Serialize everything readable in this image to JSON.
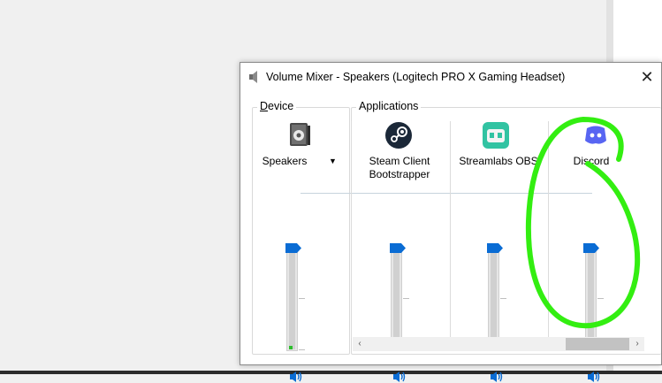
{
  "window": {
    "title": "Volume Mixer - Speakers (Logitech PRO X Gaming Headset)",
    "close_glyph": "✕"
  },
  "device": {
    "group_label": "Device",
    "name": "Speakers",
    "dropdown_glyph": "▼",
    "volume_percent": 100,
    "peak_level_percent": 2
  },
  "applications": {
    "group_label": "Applications",
    "items": [
      {
        "name_line1": "Steam Client",
        "name_line2": "Bootstrapper",
        "icon": "steam-icon",
        "volume_percent": 100
      },
      {
        "name_line1": "Streamlabs OBS",
        "name_line2": "",
        "icon": "streamlabs-icon",
        "volume_percent": 100
      },
      {
        "name_line1": "Discord",
        "name_line2": "",
        "icon": "discord-icon",
        "volume_percent": 100
      }
    ]
  },
  "scrollbar": {
    "left_glyph": "‹",
    "right_glyph": "›"
  },
  "colors": {
    "accent": "#0a6cd4",
    "annotation": "#33ee11"
  }
}
